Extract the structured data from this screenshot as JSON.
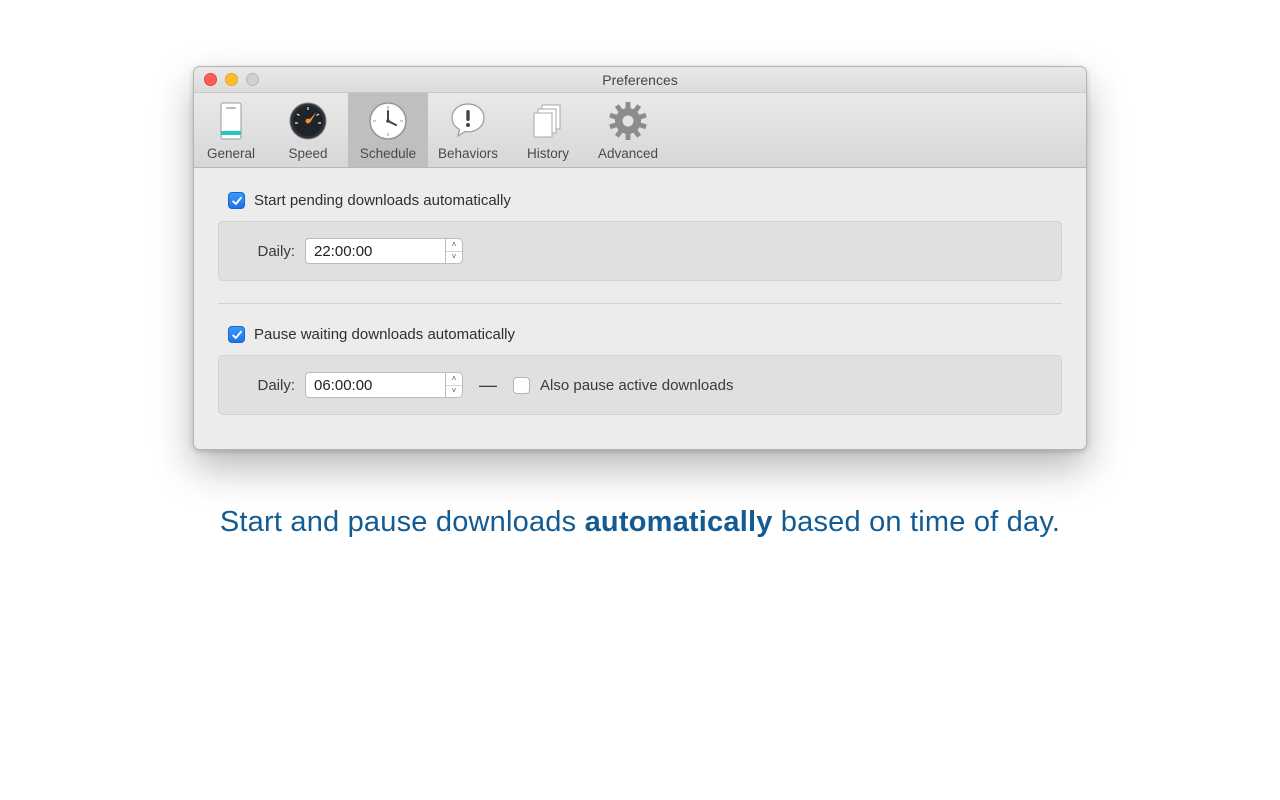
{
  "window": {
    "title": "Preferences"
  },
  "toolbar": {
    "items": [
      {
        "id": "general",
        "label": "General"
      },
      {
        "id": "speed",
        "label": "Speed"
      },
      {
        "id": "schedule",
        "label": "Schedule"
      },
      {
        "id": "behaviors",
        "label": "Behaviors"
      },
      {
        "id": "history",
        "label": "History"
      },
      {
        "id": "advanced",
        "label": "Advanced"
      }
    ],
    "selected": "schedule"
  },
  "schedule": {
    "start_checkbox_label": "Start pending downloads automatically",
    "start_checked": true,
    "start_daily_label": "Daily:",
    "start_time": "22:00:00",
    "pause_checkbox_label": "Pause waiting downloads automatically",
    "pause_checked": true,
    "pause_daily_label": "Daily:",
    "pause_time": "06:00:00",
    "also_pause_label": "Also pause active downloads",
    "also_pause_checked": false,
    "dash": "—"
  },
  "caption": {
    "pre": "Start and pause downloads ",
    "bold": "automatically",
    "post": " based on time of day."
  }
}
